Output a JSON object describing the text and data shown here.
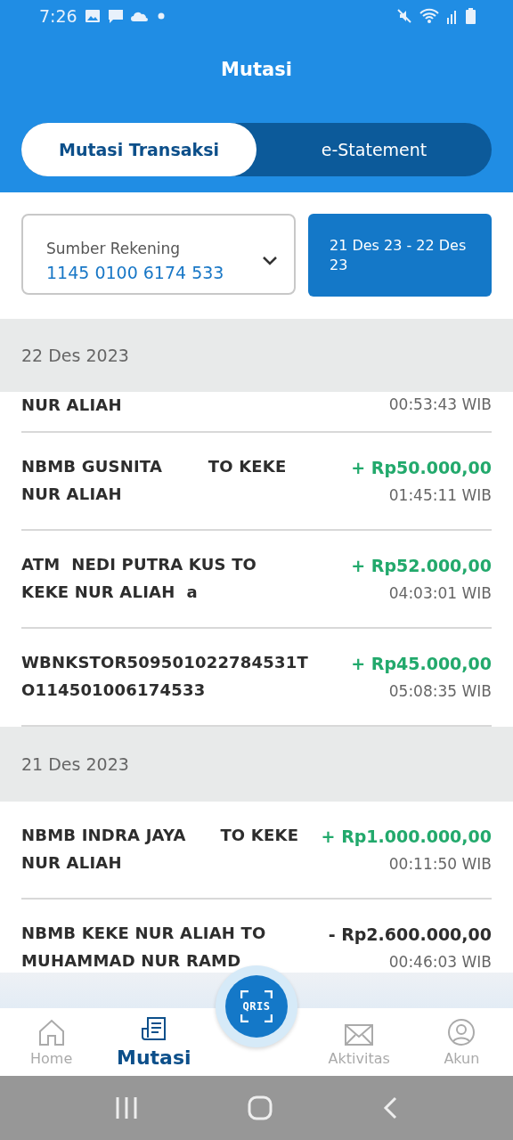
{
  "status_bar": {
    "time": "7:26"
  },
  "header": {
    "title": "Mutasi"
  },
  "tabs": [
    {
      "label": "Mutasi Transaksi",
      "selected": true
    },
    {
      "label": "e-Statement",
      "selected": false
    }
  ],
  "account": {
    "label": "Sumber Rekening",
    "number": "1145 0100 6174 533"
  },
  "date_range": "21 Des 23 - 22 Des 23",
  "groups": [
    {
      "date": "22 Des 2023",
      "transactions": [
        {
          "description": "NUR ALIAH",
          "time": "00:53:43 WIB"
        },
        {
          "description": "NBMB GUSNITA        TO KEKE\nNUR ALIAH",
          "color": "#22a96c",
          "amount": "+ Rp50.000,00",
          "time": "01:45:11 WIB"
        },
        {
          "description": "ATM  NEDI PUTRA KUS TO\nKEKE NUR ALIAH  a",
          "color": "#22a96c",
          "amount": "+ Rp52.000,00",
          "time": "04:03:01 WIB"
        },
        {
          "description": "WBNKSTOR509501022784531T\nO114501006174533",
          "color": "#22a96c",
          "amount": "+ Rp45.000,00",
          "time": "05:08:35 WIB"
        }
      ]
    },
    {
      "date": "21 Des 2023",
      "transactions": [
        {
          "description": "NBMB INDRA JAYA      TO KEKE\nNUR ALIAH",
          "color": "#22a96c",
          "amount": "+ Rp1.000.000,00",
          "time": "00:11:50 WIB"
        },
        {
          "description": "NBMB KEKE NUR ALIAH TO\nMUHAMMAD NUR RAMD",
          "color": "#2d2d2d",
          "amount": "- Rp2.600.000,00",
          "time": "00:46:03 WIB"
        }
      ]
    }
  ],
  "qris": {
    "label": "QRIS"
  },
  "bottom_nav": [
    {
      "kind": "home",
      "label": "Home",
      "selected": false
    },
    {
      "kind": "statement",
      "label": "Mutasi",
      "selected": true
    },
    {
      "kind": "mail",
      "label": "Aktivitas",
      "selected": false
    },
    {
      "kind": "account",
      "label": "Akun",
      "selected": false
    }
  ]
}
